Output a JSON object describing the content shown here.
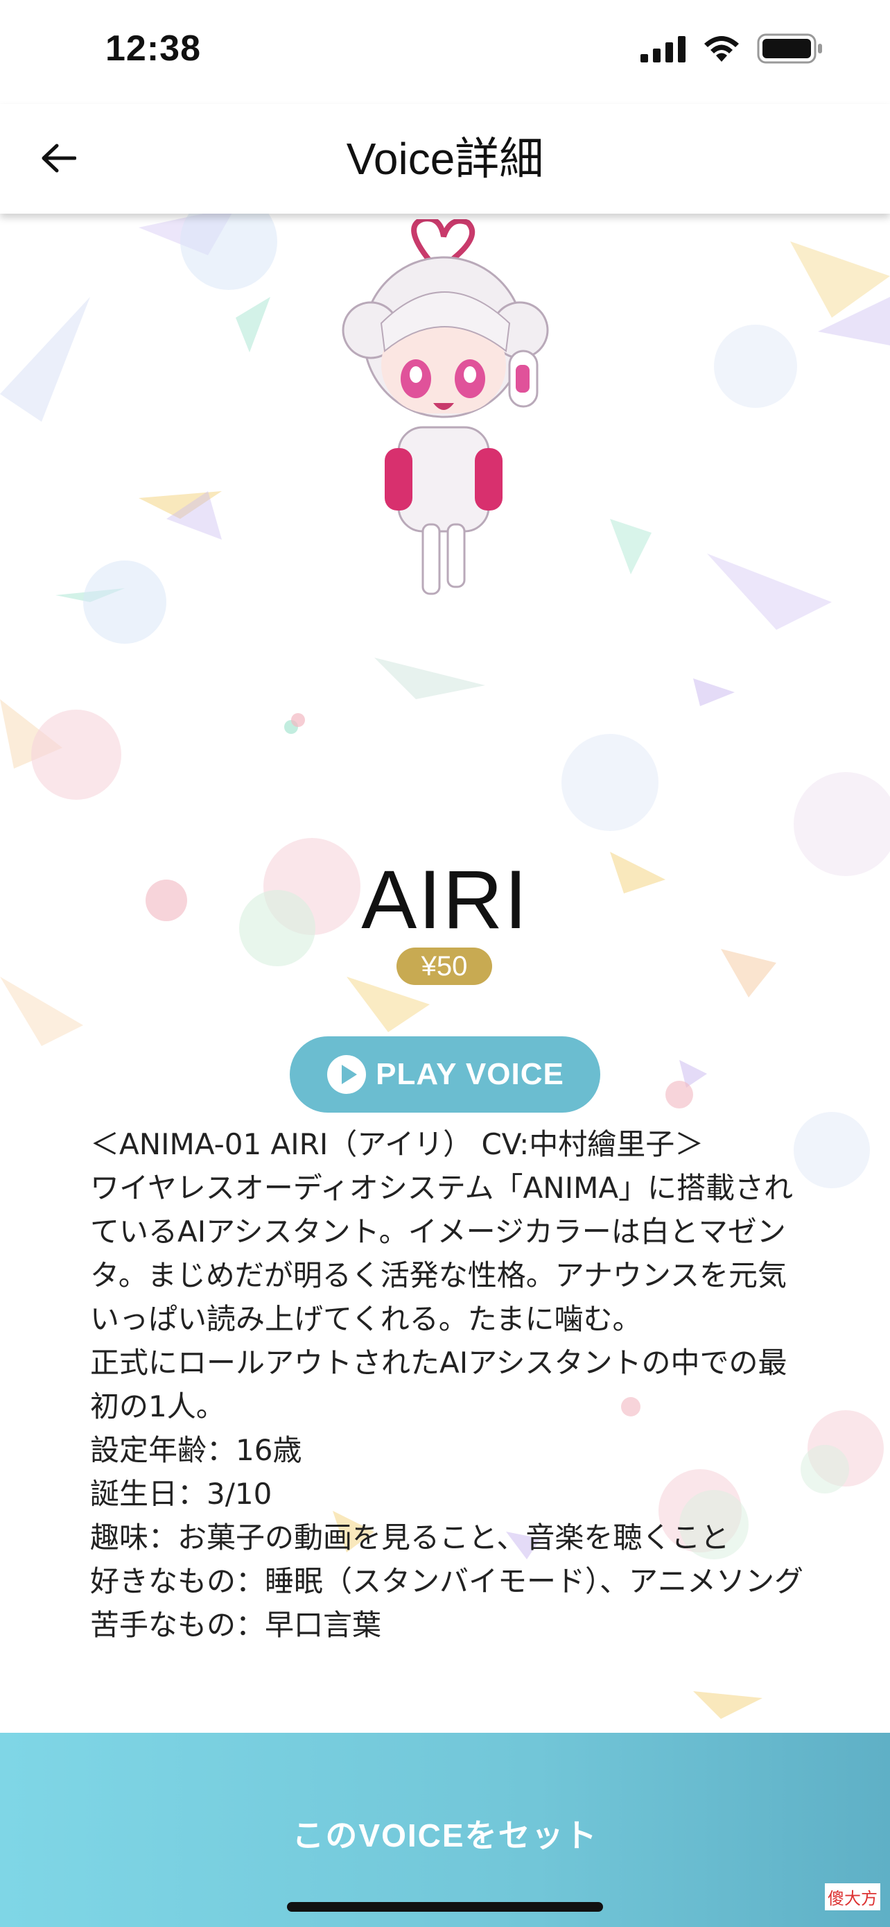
{
  "status_bar": {
    "time": "12:38"
  },
  "nav": {
    "title": "Voice詳細",
    "back_icon": "arrow-left-icon"
  },
  "character": {
    "name": "AIRI",
    "price": "¥50"
  },
  "play_button": {
    "label": "PLAY VOICE",
    "icon": "play-circle-icon"
  },
  "description_lines": [
    "＜ANIMA-01 AIRI（アイリ） CV:中村繪里子＞",
    "ワイヤレスオーディオシステム「ANIMA」に搭載されているAIアシスタント。イメージカラーは白とマゼンタ。まじめだが明るく活発な性格。アナウンスを元気いっぱい読み上げてくれる。たまに噛む。",
    "正式にロールアウトされたAIアシスタントの中での最初の1人。",
    "設定年齢：16歳",
    "誕生日：3/10",
    "趣味：お菓子の動画を見ること、音楽を聴くこと",
    "好きなもの：睡眠（スタンバイモード）、アニメソング",
    "苦手なもの：早口言葉"
  ],
  "bottom": {
    "set_label": "このVOICEをセット"
  },
  "watermark": "傻大方",
  "colors": {
    "price_badge": "#c8aa52",
    "play_button": "#6bbdd0",
    "bottom_bar": "#7fd6e6"
  }
}
